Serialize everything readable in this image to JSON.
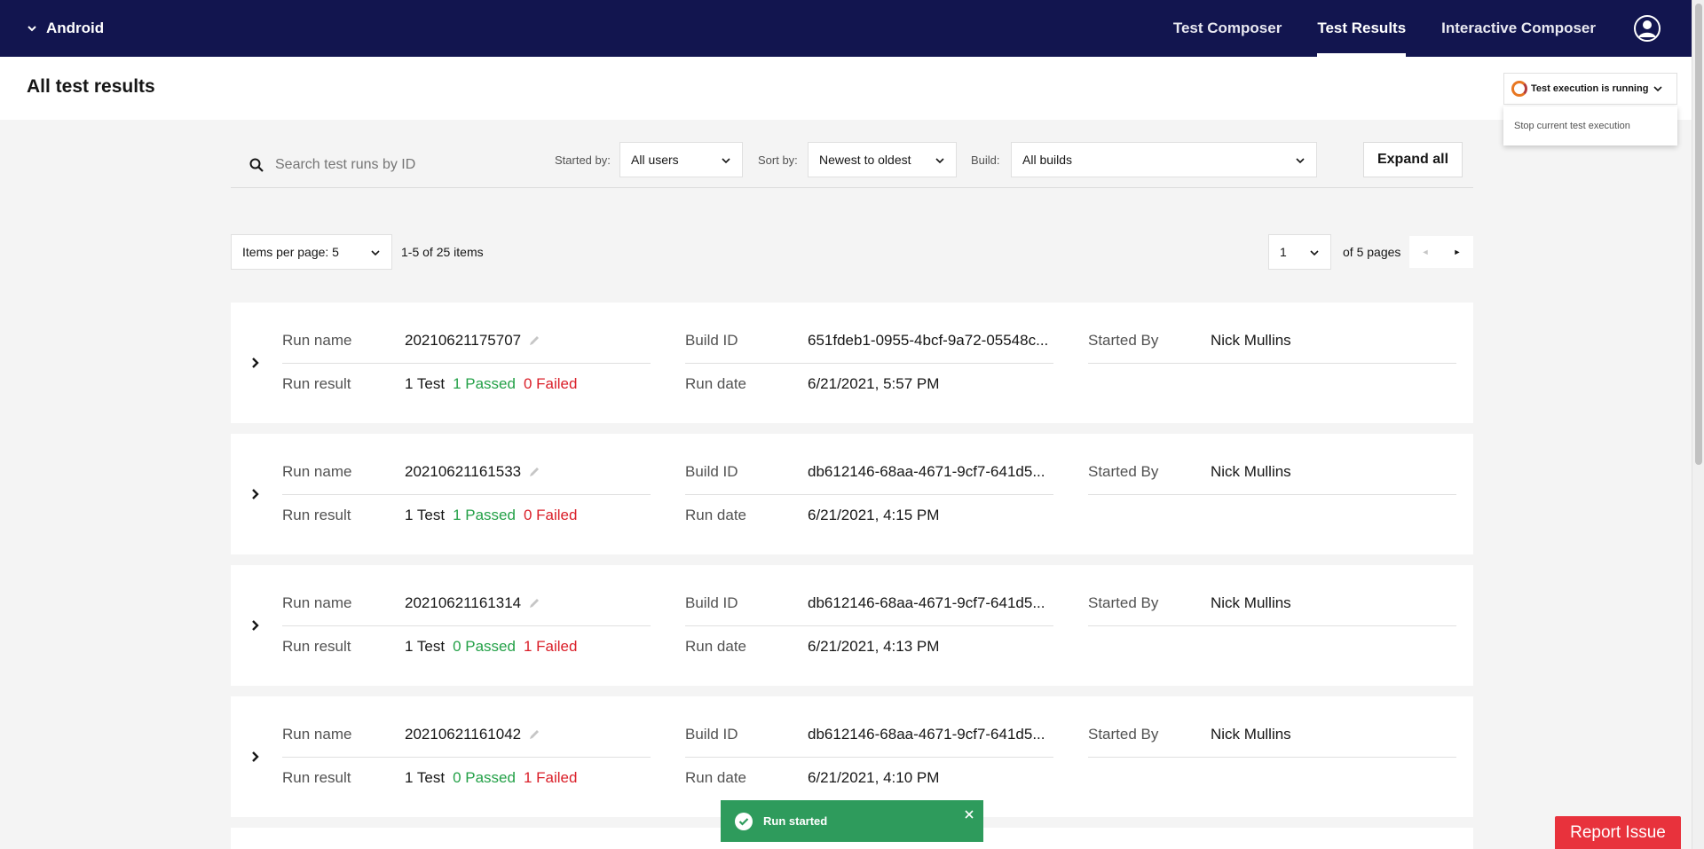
{
  "topbar": {
    "project_name": "Android",
    "nav": [
      {
        "label": "Test Composer",
        "active": false
      },
      {
        "label": "Test Results",
        "active": true
      },
      {
        "label": "Interactive Composer",
        "active": false
      }
    ]
  },
  "header": {
    "title": "All test results",
    "running_status": "Test execution is running",
    "running_menu_item": "Stop current test execution"
  },
  "filters": {
    "search_placeholder": "Search test runs by ID",
    "started_by_label": "Started by:",
    "started_by_value": "All users",
    "sort_by_label": "Sort by:",
    "sort_by_value": "Newest to oldest",
    "build_label": "Build:",
    "build_value": "All builds",
    "expand_all": "Expand all"
  },
  "pagination": {
    "items_per_page": "Items per page: 5",
    "range": "1-5 of 25 items",
    "page": "1",
    "of_pages": "of 5 pages",
    "prev_icon": "◄",
    "next_icon": "►"
  },
  "labels": {
    "run_name": "Run name",
    "run_result": "Run result",
    "build_id": "Build ID",
    "run_date": "Run date",
    "started_by": "Started By"
  },
  "runs": [
    {
      "name": "20210621175707",
      "tests": "1 Test",
      "passed": "1 Passed",
      "failed": "0 Failed",
      "build_id": "651fdeb1-0955-4bcf-9a72-05548c...",
      "date": "6/21/2021, 5:57 PM",
      "started_by": "Nick Mullins"
    },
    {
      "name": "20210621161533",
      "tests": "1 Test",
      "passed": "1 Passed",
      "failed": "0 Failed",
      "build_id": "db612146-68aa-4671-9cf7-641d5...",
      "date": "6/21/2021, 4:15 PM",
      "started_by": "Nick Mullins"
    },
    {
      "name": "20210621161314",
      "tests": "1 Test",
      "passed": "0 Passed",
      "failed": "1 Failed",
      "build_id": "db612146-68aa-4671-9cf7-641d5...",
      "date": "6/21/2021, 4:13 PM",
      "started_by": "Nick Mullins"
    },
    {
      "name": "20210621161042",
      "tests": "1 Test",
      "passed": "0 Passed",
      "failed": "1 Failed",
      "build_id": "db612146-68aa-4671-9cf7-641d5...",
      "date": "6/21/2021, 4:10 PM",
      "started_by": "Nick Mullins"
    }
  ],
  "toast": {
    "message": "Run started"
  },
  "report_issue": "Report Issue",
  "colors": {
    "nav_bg": "#12154f",
    "passed": "#24a148",
    "failed": "#da1e28",
    "toast_bg": "#2e9b5c",
    "report_bg": "#e8323c"
  }
}
